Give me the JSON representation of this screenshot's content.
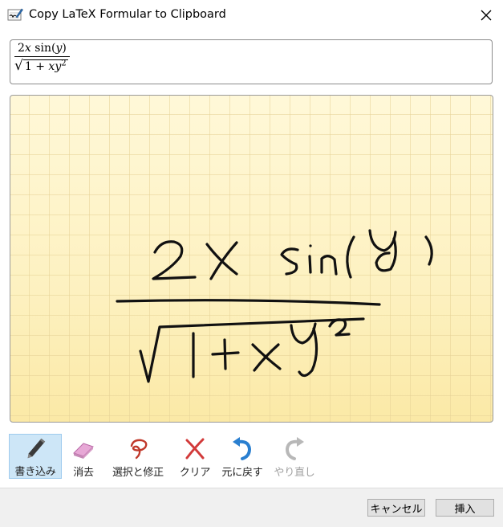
{
  "window": {
    "title": "Copy LaTeX Formular to Clipboard",
    "close_icon": "close-icon"
  },
  "preview": {
    "numerator": {
      "coef": "2",
      "var": "x",
      "func": "sin",
      "open": "(",
      "arg": "y",
      "close": ")"
    },
    "denominator": {
      "sqrt": "√",
      "one": "1",
      "plus": "+",
      "x": "x",
      "y": "y",
      "exp": "2"
    }
  },
  "canvas": {
    "ink_color": "#111111",
    "paper_color": "#fdf4c4",
    "grid_color": "#e6d296"
  },
  "toolbar": {
    "items": [
      {
        "label": "書き込み",
        "icon": "pen-icon",
        "active": true
      },
      {
        "label": "消去",
        "icon": "eraser-icon"
      },
      {
        "label": "選択と修正",
        "icon": "lasso-icon"
      },
      {
        "label": "クリア",
        "icon": "clear-icon"
      },
      {
        "label": "元に戻す",
        "icon": "undo-icon"
      },
      {
        "label": "やり直し",
        "icon": "redo-icon",
        "disabled": true
      }
    ]
  },
  "footer": {
    "cancel_label": "キャンセル",
    "insert_label": "挿入"
  },
  "colors": {
    "accent": "#cde6f7",
    "undo_blue": "#2a7fd0",
    "clear_red": "#d23a3a",
    "lasso_red": "#c0392b"
  }
}
